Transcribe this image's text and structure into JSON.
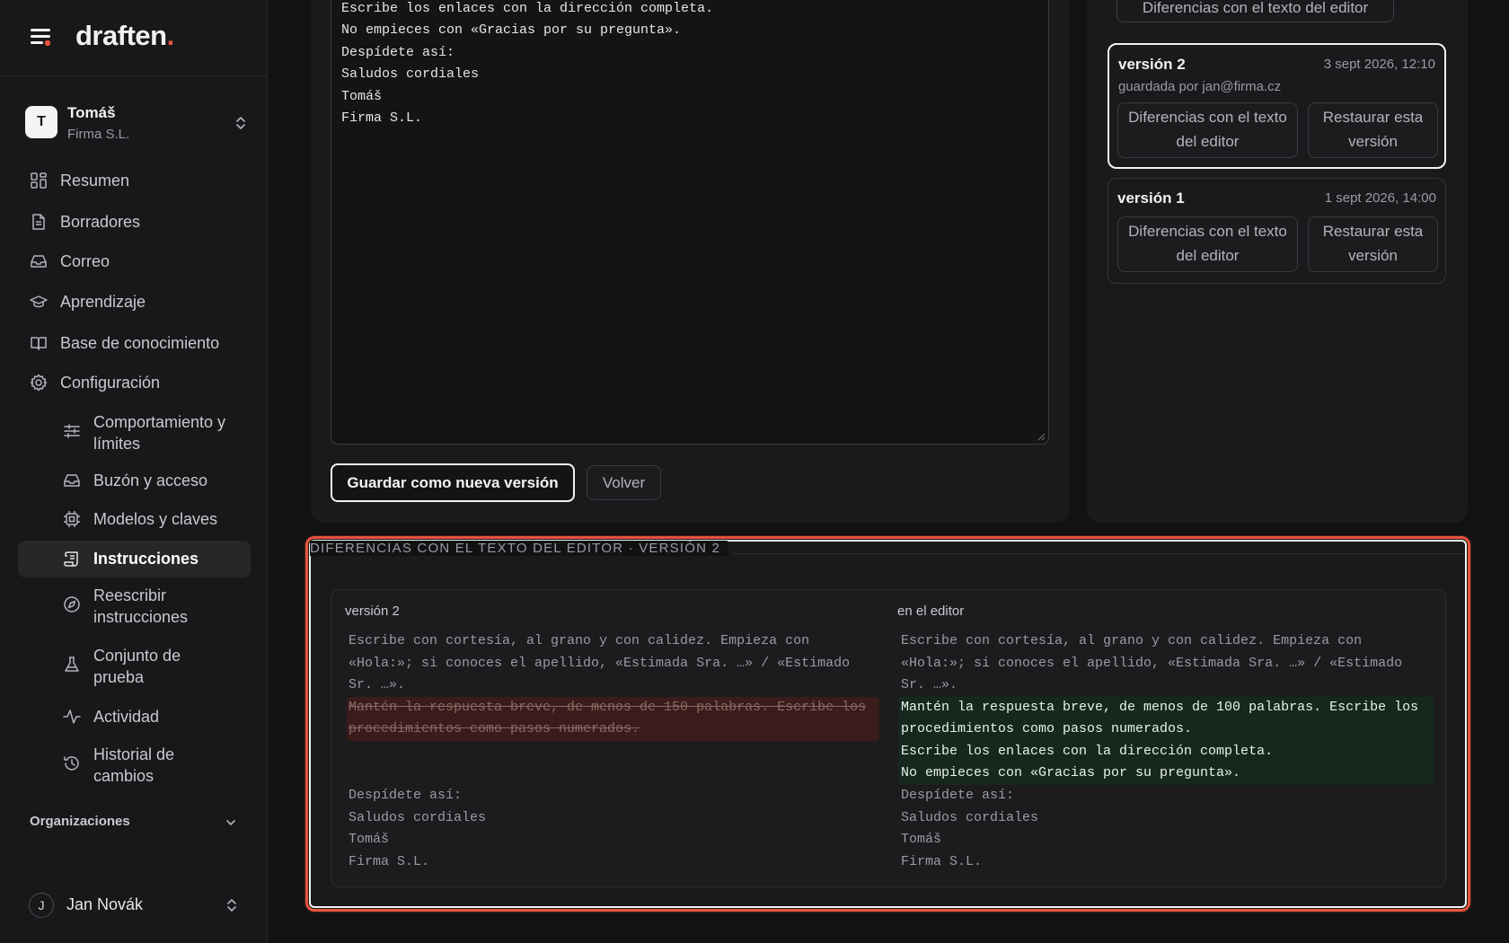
{
  "app": {
    "brand": "draften",
    "brand_dot": "."
  },
  "tenant": {
    "initial": "T",
    "name": "Tomáš",
    "org": "Firma S.L."
  },
  "nav": {
    "items": [
      {
        "label": "Resumen",
        "icon": "grid-icon"
      },
      {
        "label": "Borradores",
        "icon": "document-icon"
      },
      {
        "label": "Correo",
        "icon": "inbox-icon"
      },
      {
        "label": "Aprendizaje",
        "icon": "graduation-cap-icon"
      },
      {
        "label": "Base de conocimiento",
        "icon": "book-icon"
      },
      {
        "label": "Configuración",
        "icon": "gear-icon"
      }
    ],
    "sub_items": [
      {
        "label": "Comportamiento y límites",
        "icon": "sliders-icon"
      },
      {
        "label": "Buzón y acceso",
        "icon": "inbox-icon"
      },
      {
        "label": "Modelos y claves",
        "icon": "chip-icon"
      },
      {
        "label": "Instrucciones",
        "icon": "scroll-icon",
        "active": true
      },
      {
        "label": "Reescribir instrucciones",
        "icon": "compass-icon"
      },
      {
        "label": "Conjunto de prueba",
        "icon": "flask-icon"
      },
      {
        "label": "Actividad",
        "icon": "activity-icon"
      },
      {
        "label": "Historial de cambios",
        "icon": "history-icon"
      }
    ],
    "organizations_label": "Organizaciones"
  },
  "user": {
    "initial": "J",
    "name": "Jan Novák"
  },
  "editor": {
    "lines": [
      "Escribe los enlaces con la dirección completa.",
      "No empieces con «Gracias por su pregunta».",
      "Despídete así:",
      "Saludos cordiales",
      "Tomáš",
      "Firma S.L."
    ],
    "save_button": "Guardar como nueva versión",
    "back_button": "Volver"
  },
  "versions": {
    "top_partial_button": "Diferencias con el texto del editor",
    "cards": [
      {
        "title": "versión 2",
        "date": "3 sept 2026, 12:10",
        "saved_by": "guardada por jan@firma.cz",
        "diff_button": "Diferencias con el texto del editor",
        "restore_button": "Restaurar esta versión",
        "selected": true
      },
      {
        "title": "versión 1",
        "date": "1 sept 2026, 14:00",
        "diff_button": "Diferencias con el texto del editor",
        "restore_button": "Restaurar esta versión",
        "selected": false
      }
    ]
  },
  "diff": {
    "title": "DIFERENCIAS CON EL TEXTO DEL EDITOR · VERSIÓN 2",
    "left_header": "versión 2",
    "right_header": "en el editor",
    "left_common_top": [
      "Escribe con cortesía, al grano y con calidez. Empieza con",
      "«Hola:»; si conoces el apellido, «Estimada Sra. …» / «Estimado",
      "Sr. …»."
    ],
    "left_removed": [
      "Mantén la respuesta breve, de menos de 150 palabras. Escribe los",
      "procedimientos como pasos numerados."
    ],
    "left_common_bottom": [
      "Despídete así:",
      "Saludos cordiales",
      "Tomáš",
      "Firma S.L."
    ],
    "right_common_top": [
      "Escribe con cortesía, al grano y con calidez. Empieza con",
      "«Hola:»; si conoces el apellido, «Estimada Sra. …» / «Estimado",
      "Sr. …»."
    ],
    "right_added": [
      "Mantén la respuesta breve, de menos de 100 palabras. Escribe los",
      "procedimientos como pasos numerados.",
      "Escribe los enlaces con la dirección completa.",
      "No empieces con «Gracias por su pregunta»."
    ],
    "right_common_bottom": [
      "Despídete así:",
      "Saludos cordiales",
      "Tomáš",
      "Firma S.L."
    ]
  },
  "colors": {
    "accent": "#e5533d",
    "removed_bg": "#3a1c1a",
    "added_bg": "#16281e"
  }
}
